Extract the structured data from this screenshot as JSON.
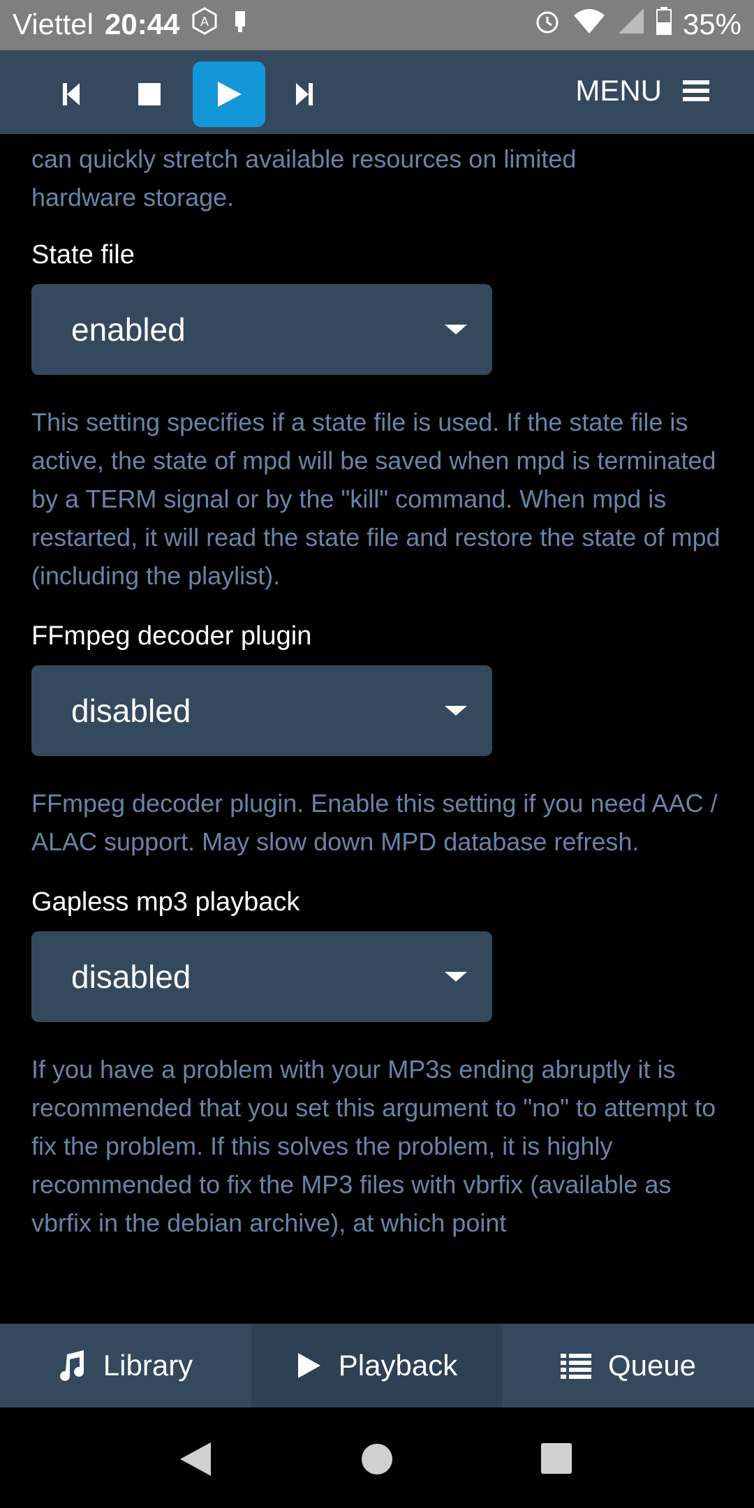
{
  "status_bar": {
    "carrier": "Viettel",
    "time": "20:44",
    "battery": "35%",
    "icons": [
      "app-icon",
      "usb-icon",
      "alarm-icon",
      "wifi-icon",
      "signal-icon",
      "battery-icon"
    ]
  },
  "player": {
    "menu_label": "MENU",
    "accent_color": "#1397d8"
  },
  "content": {
    "intro_text": "can quickly stretch available resources on limited hardware storage.",
    "settings": [
      {
        "label": "State file",
        "value": "enabled",
        "description": "This setting specifies if a state file is used. If the state file is active, the state of mpd will be saved when mpd is terminated by a TERM signal or by the \"kill\" command. When mpd is restarted, it will read the state file and restore the state of mpd (including the playlist)."
      },
      {
        "label": "FFmpeg decoder plugin",
        "value": "disabled",
        "description": "FFmpeg decoder plugin. Enable this setting if you need AAC / ALAC support. May slow down MPD database refresh."
      },
      {
        "label": "Gapless mp3 playback",
        "value": "disabled",
        "description": "If you have a problem with your MP3s ending abruptly it is recommended that you set this argument to \"no\" to attempt to fix the problem. If this solves the problem, it is highly recommended to fix the MP3 files with vbrfix (available as vbrfix in the debian archive), at which point"
      }
    ]
  },
  "tabs": [
    {
      "label": "Library",
      "icon": "music-note-icon"
    },
    {
      "label": "Playback",
      "icon": "play-icon",
      "active": true
    },
    {
      "label": "Queue",
      "icon": "list-icon"
    }
  ]
}
